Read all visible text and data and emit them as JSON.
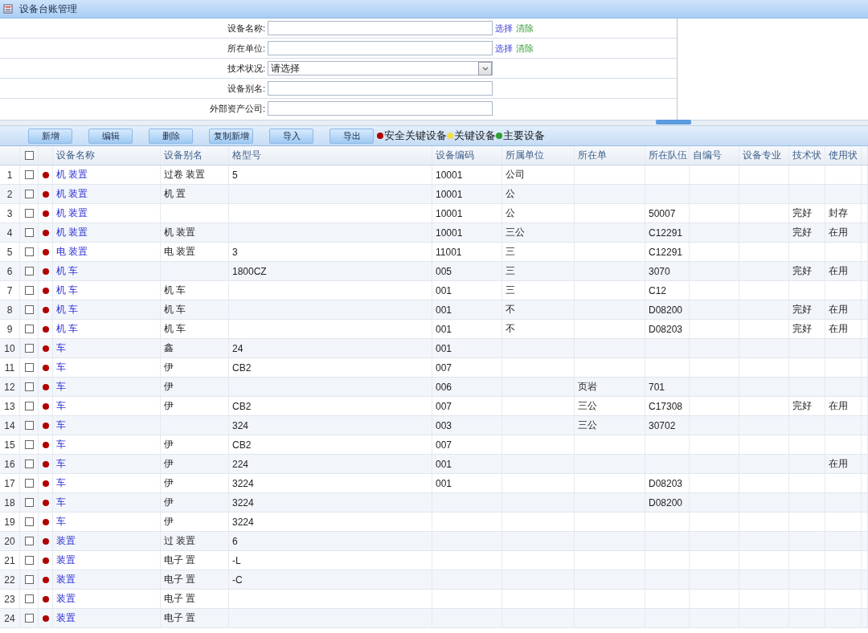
{
  "window": {
    "title": "设备台账管理"
  },
  "filters": [
    {
      "label": "设备名称:",
      "kind": "text",
      "actions": [
        "选择",
        "清除"
      ]
    },
    {
      "label": "所在单位:",
      "kind": "text",
      "actions": [
        "选择",
        "清除"
      ]
    },
    {
      "label": "技术状况:",
      "kind": "select",
      "value": "请选择"
    },
    {
      "label": "设备别名:",
      "kind": "text"
    },
    {
      "label": "外部资产公司:",
      "kind": "text"
    }
  ],
  "toolbar": {
    "buttons": [
      "新增",
      "编辑",
      "删除",
      "复制新增",
      "导入",
      "导出"
    ],
    "legend": [
      {
        "label": "安全关键设备",
        "color": "#b00000"
      },
      {
        "label": "关键设备",
        "color": "#f2e04a"
      },
      {
        "label": "主要设备",
        "color": "#2e9e2e"
      }
    ]
  },
  "table": {
    "select_all_checked": false,
    "columns": [
      "设备名称",
      "设备别名",
      "格型号",
      "设备编码",
      "所属单位",
      "所在单",
      "所在队伍",
      "自编号",
      "设备专业",
      "技术状",
      "使用状"
    ],
    "rows": [
      {
        "no": "1",
        "checked": false,
        "color": "#b00000",
        "name": "机 装置",
        "alias": "过卷 装置",
        "model": "5",
        "code": "10001",
        "unit": "公司"
      },
      {
        "no": "2",
        "checked": false,
        "color": "#b00000",
        "name": "机 装置",
        "alias": "机 置",
        "code": "10001",
        "unit": "公"
      },
      {
        "no": "3",
        "checked": false,
        "color": "#b00000",
        "name": "机 装置",
        "code": "10001",
        "unit": "公",
        "team": "50007",
        "tech": "完好",
        "use": "封存"
      },
      {
        "no": "4",
        "checked": false,
        "color": "#b00000",
        "name": "机 装置",
        "alias": "机 装置",
        "code": "10001",
        "unit": "三公",
        "team": "C12291",
        "tech": "完好",
        "use": "在用"
      },
      {
        "no": "5",
        "checked": false,
        "color": "#b00000",
        "name": "电 装置",
        "alias": "电 装置",
        "model": "3",
        "code": "11001",
        "unit": "三",
        "team": "C12291"
      },
      {
        "no": "6",
        "checked": false,
        "color": "#b00000",
        "name": "机 车",
        "model": "1800CZ",
        "code": "005",
        "unit": "三",
        "team": "3070",
        "tech": "完好",
        "use": "在用"
      },
      {
        "no": "7",
        "checked": false,
        "color": "#b00000",
        "name": "机 车",
        "alias": "机 车",
        "code": "001",
        "unit": "三",
        "team": "C12"
      },
      {
        "no": "8",
        "checked": false,
        "color": "#b00000",
        "name": "机 车",
        "alias": "机 车",
        "code": "001",
        "unit": "不",
        "team": "D08200",
        "tech": "完好",
        "use": "在用"
      },
      {
        "no": "9",
        "checked": false,
        "color": "#b00000",
        "name": "机 车",
        "alias": "机 车",
        "code": "001",
        "unit": "不",
        "team": "D08203",
        "tech": "完好",
        "use": "在用"
      },
      {
        "no": "10",
        "checked": false,
        "color": "#b00000",
        "name": "车",
        "alias": "鑫",
        "model": "24",
        "code": "001"
      },
      {
        "no": "11",
        "checked": false,
        "color": "#b00000",
        "name": "车",
        "alias": "伊",
        "model": "CB2",
        "code": "007"
      },
      {
        "no": "12",
        "checked": false,
        "color": "#b00000",
        "name": "车",
        "alias": "伊",
        "code": "006",
        "location": "页岩",
        "team": "701"
      },
      {
        "no": "13",
        "checked": false,
        "color": "#b00000",
        "name": "车",
        "alias": "伊",
        "model": "CB2",
        "code": "007",
        "location": "三公",
        "team": "C17308",
        "tech": "完好",
        "use": "在用"
      },
      {
        "no": "14",
        "checked": false,
        "color": "#b00000",
        "name": "车",
        "model": "324",
        "code": "003",
        "location": "三公",
        "team": "30702"
      },
      {
        "no": "15",
        "checked": false,
        "color": "#b00000",
        "name": "车",
        "alias": "伊",
        "model": "CB2",
        "code": "007"
      },
      {
        "no": "16",
        "checked": false,
        "color": "#b00000",
        "name": "车",
        "alias": "伊",
        "model": "224",
        "code": "001",
        "use": "在用"
      },
      {
        "no": "17",
        "checked": false,
        "color": "#b00000",
        "name": "车",
        "alias": "伊",
        "model": "3224",
        "code": "001",
        "team": "D08203"
      },
      {
        "no": "18",
        "checked": false,
        "color": "#b00000",
        "name": "车",
        "alias": "伊",
        "model": "3224",
        "team": "D08200"
      },
      {
        "no": "19",
        "checked": false,
        "color": "#b00000",
        "name": "车",
        "alias": "伊",
        "model": "3224"
      },
      {
        "no": "20",
        "checked": false,
        "color": "#b00000",
        "name": "装置",
        "alias": "过 装置",
        "model": "6"
      },
      {
        "no": "21",
        "checked": false,
        "color": "#b00000",
        "name": "装置",
        "alias": "电子 置",
        "model": "-L"
      },
      {
        "no": "22",
        "checked": false,
        "color": "#b00000",
        "name": "装置",
        "alias": "电子 置",
        "model": "-C"
      },
      {
        "no": "23",
        "checked": false,
        "color": "#b00000",
        "name": "装置",
        "alias": "电子 置"
      },
      {
        "no": "24",
        "checked": false,
        "color": "#b00000",
        "name": "装置",
        "alias": "电子 置"
      }
    ]
  }
}
